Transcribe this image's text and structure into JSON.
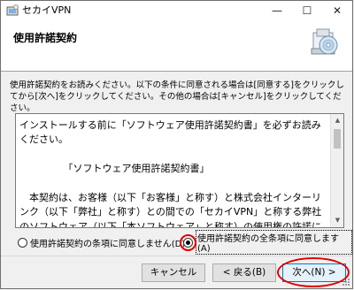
{
  "window": {
    "title": "セカイVPN",
    "minimize_glyph": "—",
    "maximize_glyph": "☐",
    "close_glyph": "✕"
  },
  "header": {
    "title": "使用許諾契約",
    "icon": "cd-installer-icon"
  },
  "instructions": "使用許諾契約をお読みください。以下の条件に同意される場合は[同意する]をクリックしてから[次へ]をクリックしてください。その他の場合は[キャンセル]をクリックしてください。",
  "license": {
    "text": "インストールする前に「ソフトウェア使用許諾契約書」を必ずお読みください。\n\n　　　　　「ソフトウェア使用許諾契約書」\n\n　本契約は、お客様（以下「お客様」と称す）と株式会社インターリンク（以下「弊社」と称す）との間での「セカイVPN」と称する弊社のソフトウェア（以下「本ソフトウェア」と称す）の使用権の許諾に関する条件を定めるものです。",
    "scroll_up_glyph": "▲",
    "scroll_down_glyph": "▼"
  },
  "options": {
    "disagree": {
      "label": "使用許諾契約の条項に同意しません(D)",
      "selected": false
    },
    "agree": {
      "label": "使用許諾契約の全条項に同意します(A)",
      "selected": true
    }
  },
  "buttons": {
    "cancel": "キャンセル",
    "back": "< 戻る(B)",
    "next": "次へ(N) >"
  },
  "colors": {
    "highlight_ring": "#e00000",
    "default_button_border": "#0078d7"
  }
}
